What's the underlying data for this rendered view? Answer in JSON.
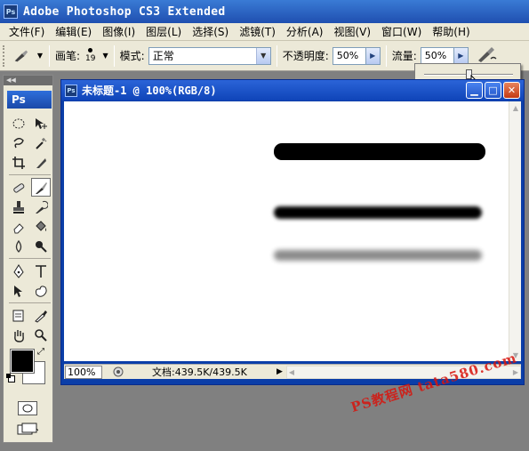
{
  "app": {
    "logo": "Ps",
    "title": "Adobe Photoshop CS3 Extended"
  },
  "menu": [
    "文件(F)",
    "编辑(E)",
    "图像(I)",
    "图层(L)",
    "选择(S)",
    "滤镜(T)",
    "分析(A)",
    "视图(V)",
    "窗口(W)",
    "帮助(H)"
  ],
  "options": {
    "brush_label": "画笔:",
    "brush_size": "19",
    "mode_label": "模式:",
    "mode_value": "正常",
    "opacity_label": "不透明度:",
    "opacity_value": "50%",
    "flow_label": "流量:",
    "flow_value": "50%",
    "flow_slider_level": 0.5
  },
  "toolbox": {
    "badge": "Ps"
  },
  "document": {
    "title": "未标题-1 @ 100%(RGB/8)",
    "zoom": "100%",
    "doc_size": "文档:439.5K/439.5K"
  },
  "canvas_strokes": [
    {
      "name": "hard-stroke",
      "opacity": 1.0,
      "blur": 0
    },
    {
      "name": "soft-stroke",
      "opacity": 1.0,
      "blur": 2
    },
    {
      "name": "faded-stroke",
      "opacity": 0.45,
      "blur": 3
    }
  ],
  "watermark": "PS教程网 tata580.com",
  "colors": {
    "foreground": "#000000",
    "background": "#ffffff",
    "title_blue": "#1f4fb0",
    "watermark_red": "#d8140d"
  }
}
